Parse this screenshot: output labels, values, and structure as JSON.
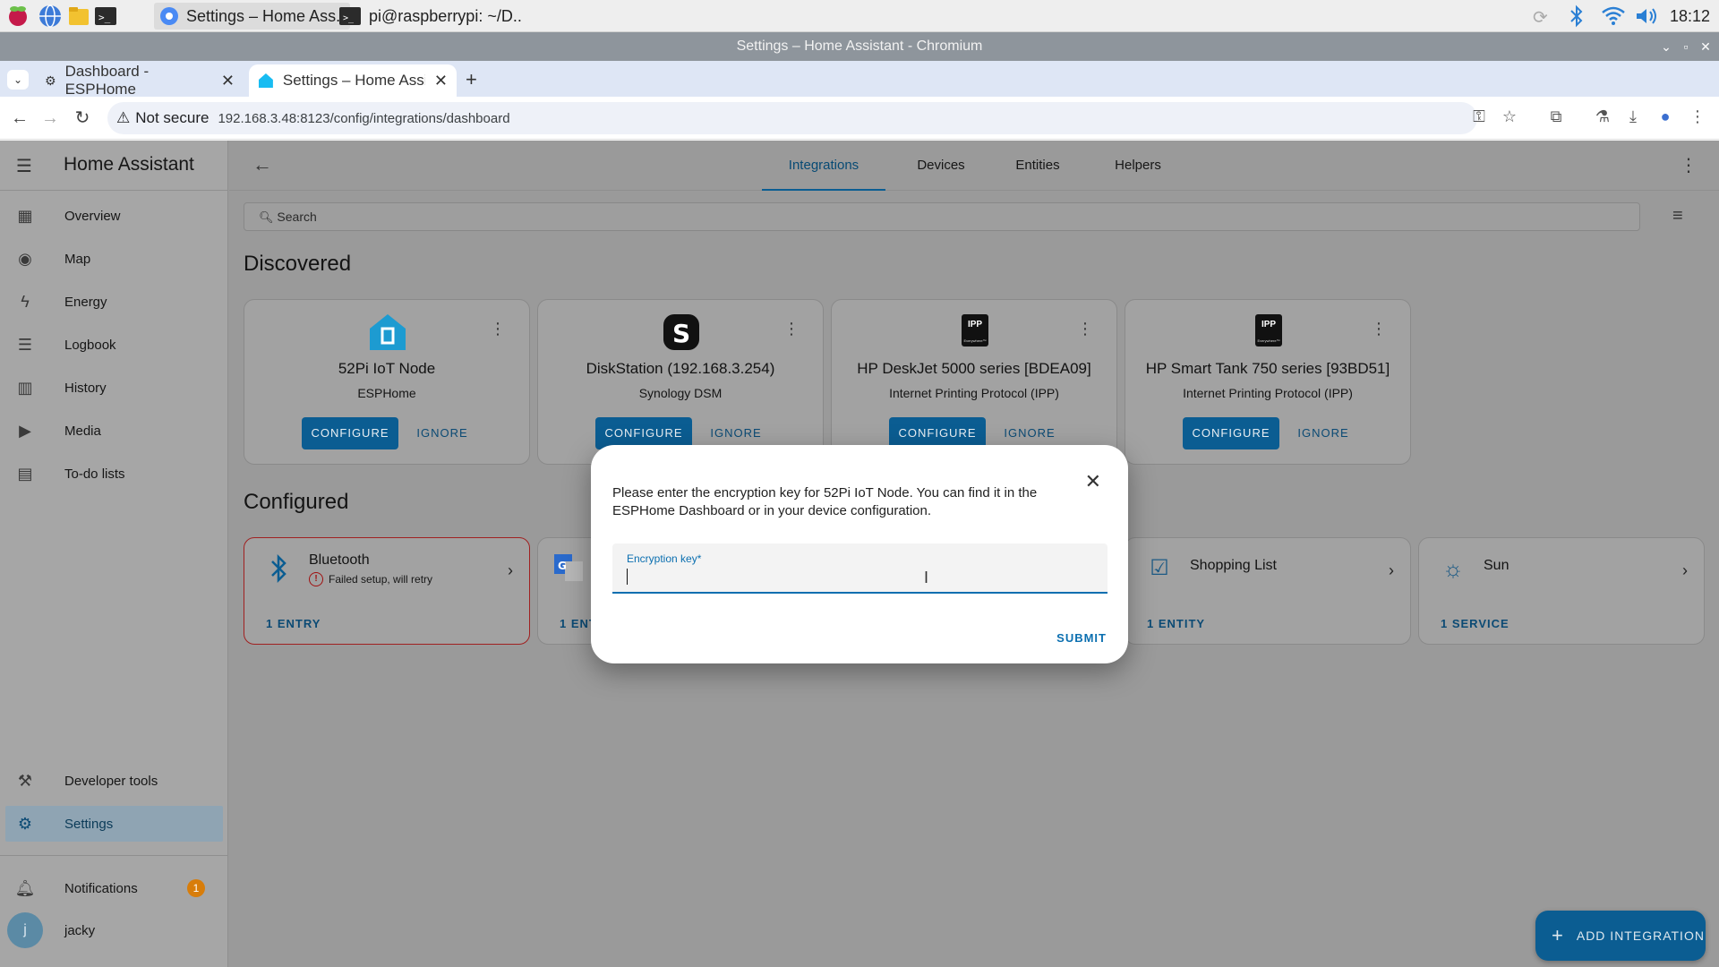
{
  "taskbar": {
    "tasks": [
      {
        "label": "Settings – Home Ass.."
      },
      {
        "label": "pi@raspberrypi: ~/D.."
      }
    ],
    "clock": "18:12"
  },
  "window": {
    "title": "Settings – Home Assistant - Chromium"
  },
  "browser": {
    "tabs": [
      {
        "label": "Dashboard - ESPHome"
      },
      {
        "label": "Settings – Home Assis"
      }
    ],
    "security_label": "Not secure",
    "url": "192.168.3.48:8123/config/integrations/dashboard"
  },
  "sidebar": {
    "title": "Home Assistant",
    "items": [
      {
        "label": "Overview"
      },
      {
        "label": "Map"
      },
      {
        "label": "Energy"
      },
      {
        "label": "Logbook"
      },
      {
        "label": "History"
      },
      {
        "label": "Media"
      },
      {
        "label": "To-do lists"
      }
    ],
    "developer_tools": "Developer tools",
    "settings": "Settings",
    "notifications": "Notifications",
    "notifications_count": "1",
    "user_initial": "j",
    "user_name": "jacky"
  },
  "header": {
    "tabs": [
      {
        "label": "Integrations"
      },
      {
        "label": "Devices"
      },
      {
        "label": "Entities"
      },
      {
        "label": "Helpers"
      }
    ]
  },
  "search": {
    "placeholder": "Search"
  },
  "discovered": {
    "title": "Discovered",
    "configure_label": "CONFIGURE",
    "ignore_label": "IGNORE",
    "cards": [
      {
        "name": "52Pi IoT Node",
        "sub": "ESPHome"
      },
      {
        "name": "DiskStation (192.168.3.254)",
        "sub": "Synology DSM"
      },
      {
        "name": "HP DeskJet 5000 series [BDEA09]",
        "sub": "Internet Printing Protocol (IPP)"
      },
      {
        "name": "HP Smart Tank 750 series [93BD51]",
        "sub": "Internet Printing Protocol (IPP)"
      }
    ],
    "ipp_logo_text": "IPP",
    "ipp_logo_sub": "Everywhere™"
  },
  "configured": {
    "title": "Configured",
    "cards": [
      {
        "title": "Bluetooth",
        "status": "Failed setup, will retry",
        "foot": "1 ENTRY"
      },
      {
        "title": "",
        "foot": "1 ENT"
      },
      {
        "title": "Shopping List",
        "foot": "1 ENTITY"
      },
      {
        "title": "Sun",
        "foot": "1 SERVICE"
      }
    ]
  },
  "fab": {
    "label": "ADD INTEGRATION"
  },
  "dialog": {
    "message": "Please enter the encryption key for 52Pi IoT Node. You can find it in the ESPHome Dashboard or in your device configuration.",
    "field_label": "Encryption key*",
    "field_value": "",
    "submit_label": "SUBMIT"
  }
}
